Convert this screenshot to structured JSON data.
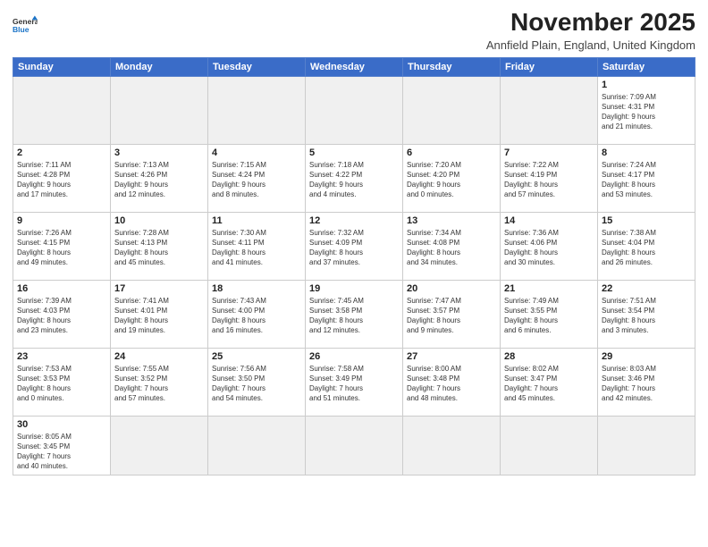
{
  "logo": {
    "line1": "General",
    "line2": "Blue"
  },
  "title": "November 2025",
  "location": "Annfield Plain, England, United Kingdom",
  "weekdays": [
    "Sunday",
    "Monday",
    "Tuesday",
    "Wednesday",
    "Thursday",
    "Friday",
    "Saturday"
  ],
  "weeks": [
    [
      {
        "day": "",
        "info": ""
      },
      {
        "day": "",
        "info": ""
      },
      {
        "day": "",
        "info": ""
      },
      {
        "day": "",
        "info": ""
      },
      {
        "day": "",
        "info": ""
      },
      {
        "day": "",
        "info": ""
      },
      {
        "day": "1",
        "info": "Sunrise: 7:09 AM\nSunset: 4:31 PM\nDaylight: 9 hours\nand 21 minutes."
      }
    ],
    [
      {
        "day": "2",
        "info": "Sunrise: 7:11 AM\nSunset: 4:28 PM\nDaylight: 9 hours\nand 17 minutes."
      },
      {
        "day": "3",
        "info": "Sunrise: 7:13 AM\nSunset: 4:26 PM\nDaylight: 9 hours\nand 12 minutes."
      },
      {
        "day": "4",
        "info": "Sunrise: 7:15 AM\nSunset: 4:24 PM\nDaylight: 9 hours\nand 8 minutes."
      },
      {
        "day": "5",
        "info": "Sunrise: 7:18 AM\nSunset: 4:22 PM\nDaylight: 9 hours\nand 4 minutes."
      },
      {
        "day": "6",
        "info": "Sunrise: 7:20 AM\nSunset: 4:20 PM\nDaylight: 9 hours\nand 0 minutes."
      },
      {
        "day": "7",
        "info": "Sunrise: 7:22 AM\nSunset: 4:19 PM\nDaylight: 8 hours\nand 57 minutes."
      },
      {
        "day": "8",
        "info": "Sunrise: 7:24 AM\nSunset: 4:17 PM\nDaylight: 8 hours\nand 53 minutes."
      }
    ],
    [
      {
        "day": "9",
        "info": "Sunrise: 7:26 AM\nSunset: 4:15 PM\nDaylight: 8 hours\nand 49 minutes."
      },
      {
        "day": "10",
        "info": "Sunrise: 7:28 AM\nSunset: 4:13 PM\nDaylight: 8 hours\nand 45 minutes."
      },
      {
        "day": "11",
        "info": "Sunrise: 7:30 AM\nSunset: 4:11 PM\nDaylight: 8 hours\nand 41 minutes."
      },
      {
        "day": "12",
        "info": "Sunrise: 7:32 AM\nSunset: 4:09 PM\nDaylight: 8 hours\nand 37 minutes."
      },
      {
        "day": "13",
        "info": "Sunrise: 7:34 AM\nSunset: 4:08 PM\nDaylight: 8 hours\nand 34 minutes."
      },
      {
        "day": "14",
        "info": "Sunrise: 7:36 AM\nSunset: 4:06 PM\nDaylight: 8 hours\nand 30 minutes."
      },
      {
        "day": "15",
        "info": "Sunrise: 7:38 AM\nSunset: 4:04 PM\nDaylight: 8 hours\nand 26 minutes."
      }
    ],
    [
      {
        "day": "16",
        "info": "Sunrise: 7:39 AM\nSunset: 4:03 PM\nDaylight: 8 hours\nand 23 minutes."
      },
      {
        "day": "17",
        "info": "Sunrise: 7:41 AM\nSunset: 4:01 PM\nDaylight: 8 hours\nand 19 minutes."
      },
      {
        "day": "18",
        "info": "Sunrise: 7:43 AM\nSunset: 4:00 PM\nDaylight: 8 hours\nand 16 minutes."
      },
      {
        "day": "19",
        "info": "Sunrise: 7:45 AM\nSunset: 3:58 PM\nDaylight: 8 hours\nand 12 minutes."
      },
      {
        "day": "20",
        "info": "Sunrise: 7:47 AM\nSunset: 3:57 PM\nDaylight: 8 hours\nand 9 minutes."
      },
      {
        "day": "21",
        "info": "Sunrise: 7:49 AM\nSunset: 3:55 PM\nDaylight: 8 hours\nand 6 minutes."
      },
      {
        "day": "22",
        "info": "Sunrise: 7:51 AM\nSunset: 3:54 PM\nDaylight: 8 hours\nand 3 minutes."
      }
    ],
    [
      {
        "day": "23",
        "info": "Sunrise: 7:53 AM\nSunset: 3:53 PM\nDaylight: 8 hours\nand 0 minutes."
      },
      {
        "day": "24",
        "info": "Sunrise: 7:55 AM\nSunset: 3:52 PM\nDaylight: 7 hours\nand 57 minutes."
      },
      {
        "day": "25",
        "info": "Sunrise: 7:56 AM\nSunset: 3:50 PM\nDaylight: 7 hours\nand 54 minutes."
      },
      {
        "day": "26",
        "info": "Sunrise: 7:58 AM\nSunset: 3:49 PM\nDaylight: 7 hours\nand 51 minutes."
      },
      {
        "day": "27",
        "info": "Sunrise: 8:00 AM\nSunset: 3:48 PM\nDaylight: 7 hours\nand 48 minutes."
      },
      {
        "day": "28",
        "info": "Sunrise: 8:02 AM\nSunset: 3:47 PM\nDaylight: 7 hours\nand 45 minutes."
      },
      {
        "day": "29",
        "info": "Sunrise: 8:03 AM\nSunset: 3:46 PM\nDaylight: 7 hours\nand 42 minutes."
      }
    ],
    [
      {
        "day": "30",
        "info": "Sunrise: 8:05 AM\nSunset: 3:45 PM\nDaylight: 7 hours\nand 40 minutes."
      },
      {
        "day": "",
        "info": ""
      },
      {
        "day": "",
        "info": ""
      },
      {
        "day": "",
        "info": ""
      },
      {
        "day": "",
        "info": ""
      },
      {
        "day": "",
        "info": ""
      },
      {
        "day": "",
        "info": ""
      }
    ]
  ]
}
